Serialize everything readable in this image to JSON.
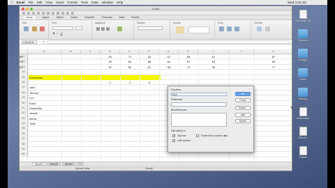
{
  "menubar": {
    "app": "Excel",
    "items": [
      "File",
      "Edit",
      "View",
      "Insert",
      "Format",
      "Tools",
      "Data",
      "Window",
      "Help"
    ],
    "right": "Wed 3:16 AM"
  },
  "window": {
    "title": "Count"
  },
  "ribbon": {
    "tabs": [
      "Home",
      "Layout",
      "Tables",
      "Charts",
      "SmartArt",
      "Formulas",
      "Data",
      "Review"
    ],
    "groups": [
      "Edit",
      "Font",
      "Alignment",
      "Number",
      "Format",
      "Cells",
      "Themes"
    ]
  },
  "formula_bar": {
    "name_box": "COUNTIF",
    "fx": "fx"
  },
  "columns": [
    "",
    "A",
    "B",
    "C",
    "D",
    "E",
    "F",
    "G",
    "H",
    "I",
    "J",
    "K"
  ],
  "rows": [
    {
      "n": "41",
      "cells": [
        "",
        "",
        "",
        "90",
        "72",
        "82",
        "67",
        "98",
        "61",
        "",
        "87",
        "89"
      ]
    },
    {
      "n": "42",
      "cells": [
        "",
        "",
        "",
        "99",
        "69",
        "88",
        "64",
        "97",
        "83",
        "",
        "89",
        "76"
      ]
    },
    {
      "n": "43",
      "cells": [
        "",
        "",
        "",
        "87",
        "82",
        "67",
        "98",
        "73",
        "90",
        "",
        "77",
        "81"
      ]
    },
    {
      "n": "44",
      "cells": [
        "",
        "",
        "",
        "",
        "",
        "",
        "",
        "",
        "",
        "",
        "",
        ""
      ]
    },
    {
      "n": "45",
      "cells": [
        "Homework",
        "",
        "",
        "",
        "",
        "",
        "",
        "",
        "",
        "",
        "",
        ""
      ],
      "highlight": true
    },
    {
      "n": "46",
      "cells": [
        "",
        "",
        "",
        "1",
        "2",
        "3",
        "",
        "",
        "",
        "",
        "",
        ""
      ]
    },
    {
      "n": "47",
      "cells": [
        "Jake",
        "",
        "",
        "",
        "",
        "",
        "",
        "",
        "",
        "",
        "",
        ""
      ]
    },
    {
      "n": "48",
      "cells": [
        "Tommy",
        "",
        "",
        "",
        "",
        "",
        "",
        "",
        "",
        "",
        "",
        ""
      ]
    },
    {
      "n": "49",
      "cells": [
        "Lex",
        "",
        "",
        "",
        "",
        "",
        "",
        "",
        "",
        "",
        "",
        ""
      ]
    },
    {
      "n": "50",
      "cells": [
        "Kane",
        "",
        "",
        "",
        "",
        "",
        "",
        "",
        "",
        "",
        "",
        ""
      ]
    },
    {
      "n": "51",
      "cells": [
        "Samantha",
        "",
        "",
        "",
        "",
        "",
        "",
        "",
        "",
        "",
        "",
        ""
      ]
    },
    {
      "n": "52",
      "cells": [
        "Jeanie",
        "",
        "",
        "",
        "",
        "",
        "",
        "",
        "",
        "",
        "",
        ""
      ]
    },
    {
      "n": "53",
      "cells": [
        "Alexa",
        "",
        "",
        "",
        "",
        "",
        "",
        "",
        "",
        "",
        "",
        ""
      ]
    },
    {
      "n": "54",
      "cells": [
        "Total",
        "",
        "",
        "",
        "",
        "",
        "",
        "",
        "",
        "",
        "",
        ""
      ]
    },
    {
      "n": "55",
      "cells": [
        "",
        "",
        "",
        "",
        "",
        "",
        "",
        "",
        "",
        "",
        "",
        ""
      ]
    },
    {
      "n": "56",
      "cells": [
        "",
        "",
        "",
        "",
        "",
        "",
        "",
        "",
        "",
        "",
        "",
        ""
      ]
    },
    {
      "n": "57",
      "cells": [
        "",
        "",
        "",
        "",
        "",
        "",
        "",
        "",
        "",
        "",
        "",
        ""
      ]
    },
    {
      "n": "58",
      "cells": [
        "",
        "",
        "",
        "",
        "",
        "",
        "",
        "",
        "",
        "",
        "",
        ""
      ]
    },
    {
      "n": "59",
      "cells": [
        "",
        "",
        "",
        "",
        "",
        "",
        "",
        "",
        "",
        "",
        "",
        ""
      ]
    },
    {
      "n": "60",
      "cells": [
        "",
        "",
        "",
        "",
        "",
        "",
        "",
        "",
        "",
        "",
        "",
        ""
      ]
    }
  ],
  "sheet_tabs": [
    "Sheet1",
    "Sheet2",
    "Sheet3"
  ],
  "status": {
    "view": "Normal View",
    "ready": "Ready"
  },
  "dialog": {
    "title": "Function Arguments",
    "function_label": "Function:",
    "function_value": "Sum",
    "reference_label": "Reference",
    "all_references_label": "All references:",
    "use_labels_label": "Use labels in",
    "top_row": "Top row",
    "left_column": "Left column",
    "create_links": "Create links to source data",
    "buttons": {
      "ok": "OK",
      "close": "Close",
      "select": "Select...",
      "add": "Add",
      "delete": "Delete"
    }
  },
  "desktop_icons": [
    {
      "label": "Macintosh HD",
      "kind": "doc"
    },
    {
      "label": "Tutorials",
      "kind": "folder"
    },
    {
      "label": "Budget",
      "kind": "folder"
    },
    {
      "label": "Notes",
      "kind": "folder"
    },
    {
      "label": "Backup",
      "kind": "folder"
    },
    {
      "label": "Downloads",
      "kind": "doc"
    },
    {
      "label": "Reports",
      "kind": "doc"
    },
    {
      "label": "Grades",
      "kind": "doc"
    }
  ],
  "colors": {
    "highlight": "#f5f500",
    "ok_button": "#6aa3e8",
    "desktop": "#5a6e98"
  }
}
